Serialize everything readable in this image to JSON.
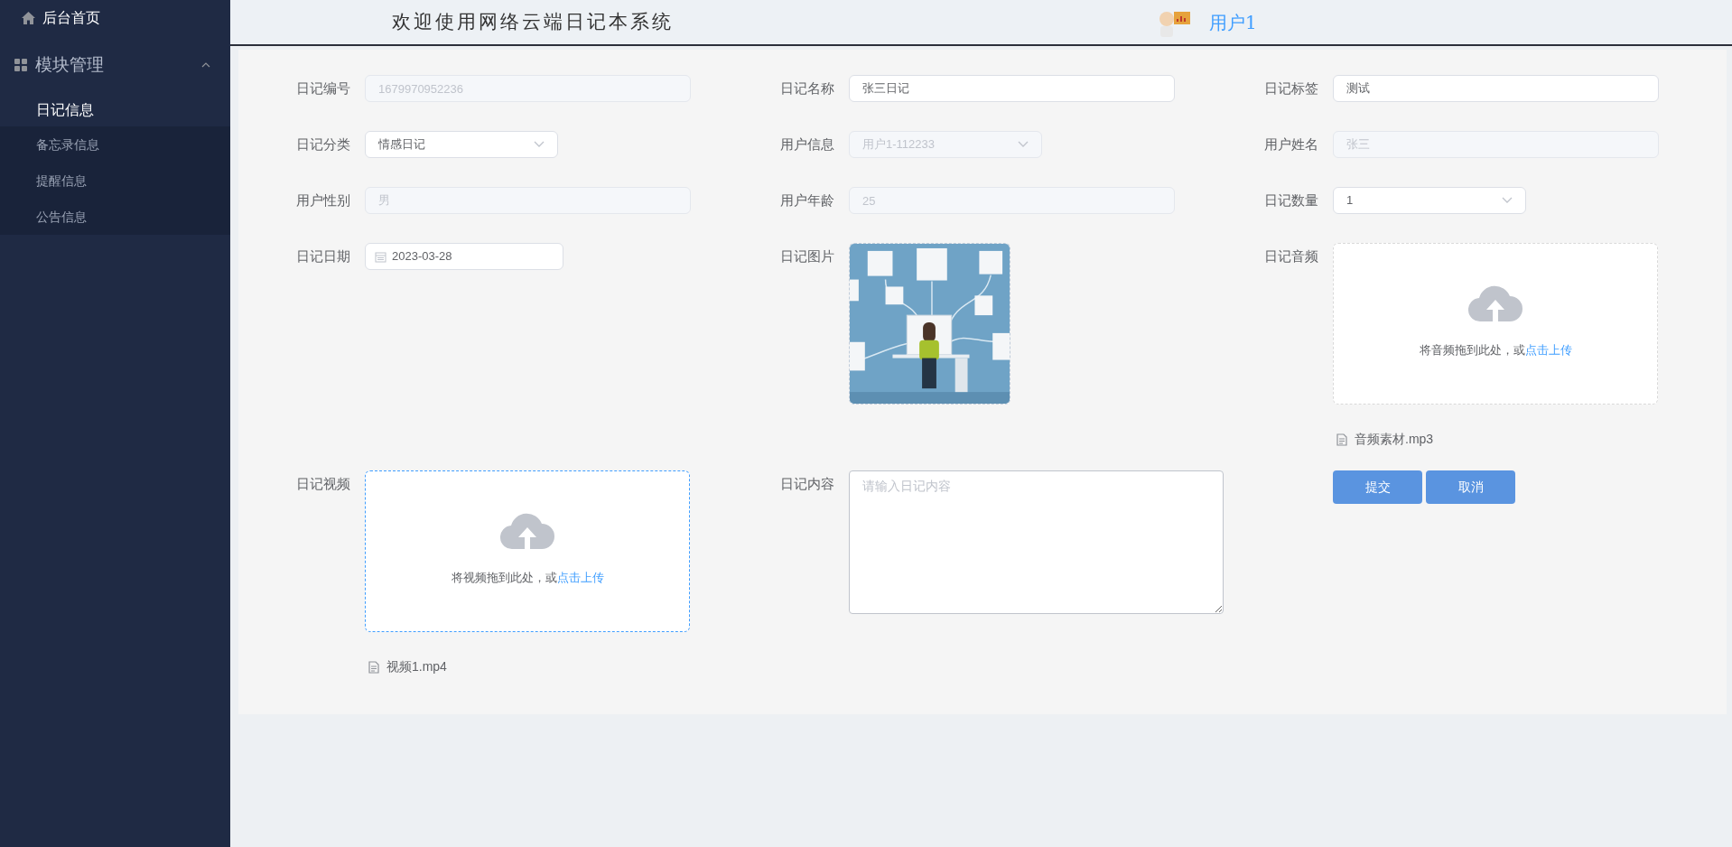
{
  "sidebar": {
    "home": {
      "label": "后台首页"
    },
    "group": {
      "label": "模块管理",
      "expanded": true
    },
    "items": [
      {
        "label": "日记信息",
        "selected": true
      },
      {
        "label": "备忘录信息",
        "selected": false
      },
      {
        "label": "提醒信息",
        "selected": false
      },
      {
        "label": "公告信息",
        "selected": false
      }
    ]
  },
  "header": {
    "title": "欢迎使用网络云端日记本系统",
    "user": "用户1"
  },
  "form": {
    "rows": [
      {
        "fields": [
          {
            "kind": "input",
            "label": "日记编号",
            "value": "1679970952236",
            "disabled": true
          },
          {
            "kind": "input",
            "label": "日记名称",
            "value": "张三日记",
            "disabled": false
          },
          {
            "kind": "input",
            "label": "日记标签",
            "value": "测试",
            "disabled": false
          }
        ]
      },
      {
        "fields": [
          {
            "kind": "select",
            "label": "日记分类",
            "value": "情感日记",
            "disabled": false
          },
          {
            "kind": "select",
            "label": "用户信息",
            "value": "用户1-112233",
            "disabled": true
          },
          {
            "kind": "input",
            "label": "用户姓名",
            "value": "张三",
            "disabled": true
          }
        ]
      },
      {
        "fields": [
          {
            "kind": "input",
            "label": "用户性别",
            "value": "男",
            "disabled": true
          },
          {
            "kind": "input",
            "label": "用户年龄",
            "value": "25",
            "disabled": true
          },
          {
            "kind": "select",
            "label": "日记数量",
            "value": "1",
            "disabled": false
          }
        ]
      },
      {
        "fields": [
          {
            "kind": "date",
            "label": "日记日期",
            "value": "2023-03-28"
          },
          {
            "label": "日记图片"
          },
          {
            "kind": "upload",
            "label": "日记音频",
            "hint": "将音频拖到此处，或",
            "link": "点击上传",
            "file": "音频素材.mp3",
            "focused": false
          }
        ]
      },
      {
        "fields": [
          {
            "kind": "upload",
            "label": "日记视频",
            "hint": "将视频拖到此处，或",
            "link": "点击上传",
            "file": "视频1.mp4",
            "focused": true
          },
          {
            "kind": "textarea",
            "label": "日记内容",
            "placeholder": "请输入日记内容"
          },
          {
            "kind": "buttons",
            "buttons": [
              "提交",
              "取消"
            ]
          }
        ]
      }
    ]
  }
}
